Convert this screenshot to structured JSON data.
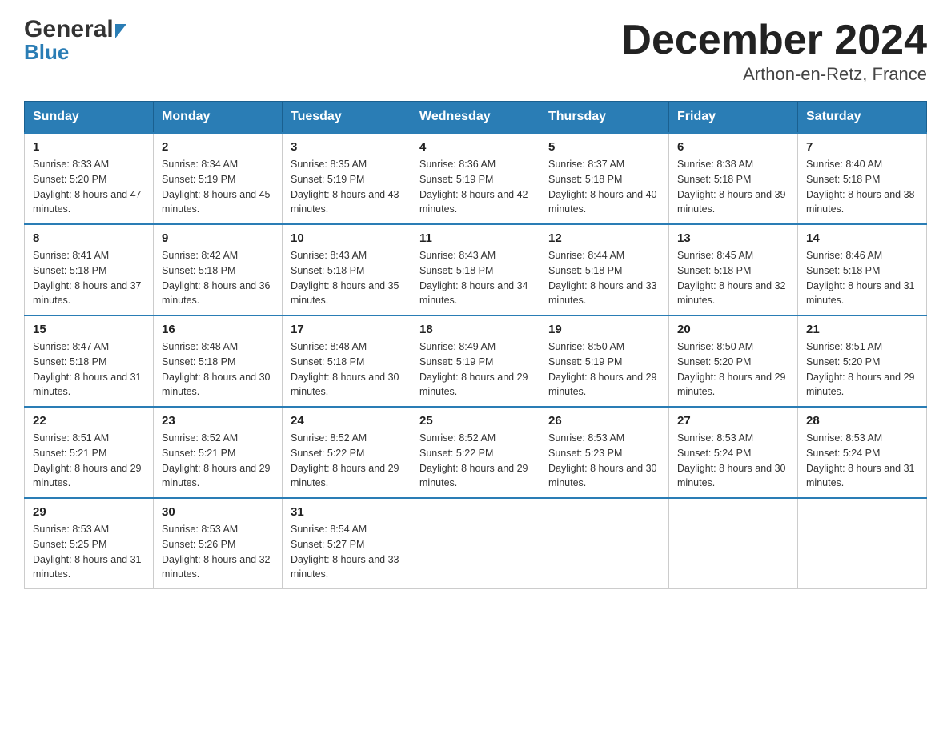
{
  "header": {
    "title": "December 2024",
    "subtitle": "Arthon-en-Retz, France",
    "logo_general": "General",
    "logo_blue": "Blue"
  },
  "columns": [
    "Sunday",
    "Monday",
    "Tuesday",
    "Wednesday",
    "Thursday",
    "Friday",
    "Saturday"
  ],
  "weeks": [
    [
      {
        "day": "1",
        "sunrise": "Sunrise: 8:33 AM",
        "sunset": "Sunset: 5:20 PM",
        "daylight": "Daylight: 8 hours and 47 minutes."
      },
      {
        "day": "2",
        "sunrise": "Sunrise: 8:34 AM",
        "sunset": "Sunset: 5:19 PM",
        "daylight": "Daylight: 8 hours and 45 minutes."
      },
      {
        "day": "3",
        "sunrise": "Sunrise: 8:35 AM",
        "sunset": "Sunset: 5:19 PM",
        "daylight": "Daylight: 8 hours and 43 minutes."
      },
      {
        "day": "4",
        "sunrise": "Sunrise: 8:36 AM",
        "sunset": "Sunset: 5:19 PM",
        "daylight": "Daylight: 8 hours and 42 minutes."
      },
      {
        "day": "5",
        "sunrise": "Sunrise: 8:37 AM",
        "sunset": "Sunset: 5:18 PM",
        "daylight": "Daylight: 8 hours and 40 minutes."
      },
      {
        "day": "6",
        "sunrise": "Sunrise: 8:38 AM",
        "sunset": "Sunset: 5:18 PM",
        "daylight": "Daylight: 8 hours and 39 minutes."
      },
      {
        "day": "7",
        "sunrise": "Sunrise: 8:40 AM",
        "sunset": "Sunset: 5:18 PM",
        "daylight": "Daylight: 8 hours and 38 minutes."
      }
    ],
    [
      {
        "day": "8",
        "sunrise": "Sunrise: 8:41 AM",
        "sunset": "Sunset: 5:18 PM",
        "daylight": "Daylight: 8 hours and 37 minutes."
      },
      {
        "day": "9",
        "sunrise": "Sunrise: 8:42 AM",
        "sunset": "Sunset: 5:18 PM",
        "daylight": "Daylight: 8 hours and 36 minutes."
      },
      {
        "day": "10",
        "sunrise": "Sunrise: 8:43 AM",
        "sunset": "Sunset: 5:18 PM",
        "daylight": "Daylight: 8 hours and 35 minutes."
      },
      {
        "day": "11",
        "sunrise": "Sunrise: 8:43 AM",
        "sunset": "Sunset: 5:18 PM",
        "daylight": "Daylight: 8 hours and 34 minutes."
      },
      {
        "day": "12",
        "sunrise": "Sunrise: 8:44 AM",
        "sunset": "Sunset: 5:18 PM",
        "daylight": "Daylight: 8 hours and 33 minutes."
      },
      {
        "day": "13",
        "sunrise": "Sunrise: 8:45 AM",
        "sunset": "Sunset: 5:18 PM",
        "daylight": "Daylight: 8 hours and 32 minutes."
      },
      {
        "day": "14",
        "sunrise": "Sunrise: 8:46 AM",
        "sunset": "Sunset: 5:18 PM",
        "daylight": "Daylight: 8 hours and 31 minutes."
      }
    ],
    [
      {
        "day": "15",
        "sunrise": "Sunrise: 8:47 AM",
        "sunset": "Sunset: 5:18 PM",
        "daylight": "Daylight: 8 hours and 31 minutes."
      },
      {
        "day": "16",
        "sunrise": "Sunrise: 8:48 AM",
        "sunset": "Sunset: 5:18 PM",
        "daylight": "Daylight: 8 hours and 30 minutes."
      },
      {
        "day": "17",
        "sunrise": "Sunrise: 8:48 AM",
        "sunset": "Sunset: 5:18 PM",
        "daylight": "Daylight: 8 hours and 30 minutes."
      },
      {
        "day": "18",
        "sunrise": "Sunrise: 8:49 AM",
        "sunset": "Sunset: 5:19 PM",
        "daylight": "Daylight: 8 hours and 29 minutes."
      },
      {
        "day": "19",
        "sunrise": "Sunrise: 8:50 AM",
        "sunset": "Sunset: 5:19 PM",
        "daylight": "Daylight: 8 hours and 29 minutes."
      },
      {
        "day": "20",
        "sunrise": "Sunrise: 8:50 AM",
        "sunset": "Sunset: 5:20 PM",
        "daylight": "Daylight: 8 hours and 29 minutes."
      },
      {
        "day": "21",
        "sunrise": "Sunrise: 8:51 AM",
        "sunset": "Sunset: 5:20 PM",
        "daylight": "Daylight: 8 hours and 29 minutes."
      }
    ],
    [
      {
        "day": "22",
        "sunrise": "Sunrise: 8:51 AM",
        "sunset": "Sunset: 5:21 PM",
        "daylight": "Daylight: 8 hours and 29 minutes."
      },
      {
        "day": "23",
        "sunrise": "Sunrise: 8:52 AM",
        "sunset": "Sunset: 5:21 PM",
        "daylight": "Daylight: 8 hours and 29 minutes."
      },
      {
        "day": "24",
        "sunrise": "Sunrise: 8:52 AM",
        "sunset": "Sunset: 5:22 PM",
        "daylight": "Daylight: 8 hours and 29 minutes."
      },
      {
        "day": "25",
        "sunrise": "Sunrise: 8:52 AM",
        "sunset": "Sunset: 5:22 PM",
        "daylight": "Daylight: 8 hours and 29 minutes."
      },
      {
        "day": "26",
        "sunrise": "Sunrise: 8:53 AM",
        "sunset": "Sunset: 5:23 PM",
        "daylight": "Daylight: 8 hours and 30 minutes."
      },
      {
        "day": "27",
        "sunrise": "Sunrise: 8:53 AM",
        "sunset": "Sunset: 5:24 PM",
        "daylight": "Daylight: 8 hours and 30 minutes."
      },
      {
        "day": "28",
        "sunrise": "Sunrise: 8:53 AM",
        "sunset": "Sunset: 5:24 PM",
        "daylight": "Daylight: 8 hours and 31 minutes."
      }
    ],
    [
      {
        "day": "29",
        "sunrise": "Sunrise: 8:53 AM",
        "sunset": "Sunset: 5:25 PM",
        "daylight": "Daylight: 8 hours and 31 minutes."
      },
      {
        "day": "30",
        "sunrise": "Sunrise: 8:53 AM",
        "sunset": "Sunset: 5:26 PM",
        "daylight": "Daylight: 8 hours and 32 minutes."
      },
      {
        "day": "31",
        "sunrise": "Sunrise: 8:54 AM",
        "sunset": "Sunset: 5:27 PM",
        "daylight": "Daylight: 8 hours and 33 minutes."
      },
      null,
      null,
      null,
      null
    ]
  ]
}
